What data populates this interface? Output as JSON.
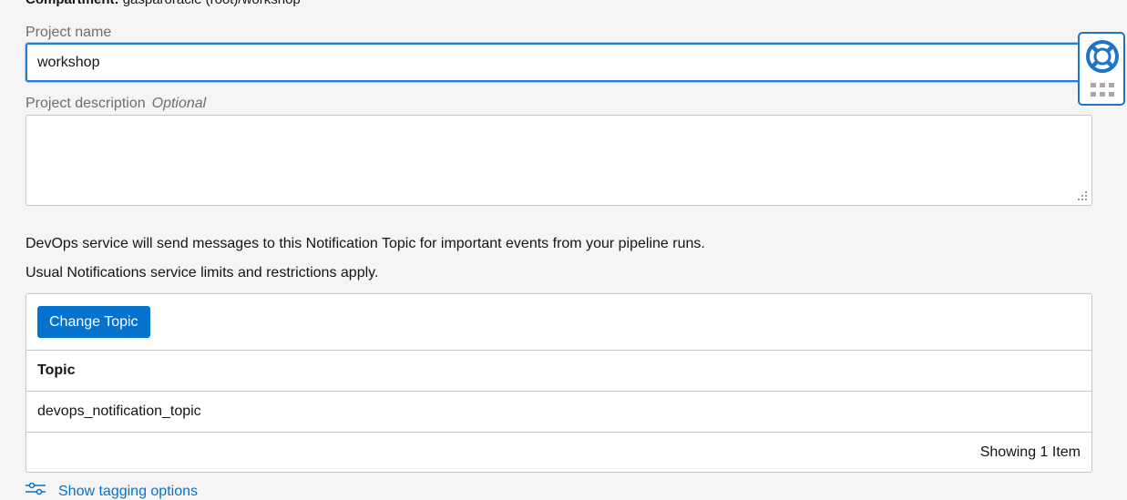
{
  "compartment": {
    "label": "Compartment:",
    "value": "gasparoracle (root)/workshop"
  },
  "project_name": {
    "label": "Project name",
    "value": "workshop"
  },
  "project_description": {
    "label": "Project description",
    "optional_label": "Optional",
    "value": ""
  },
  "notification": {
    "line1": "DevOps service will send messages to this Notification Topic for important events from your pipeline runs.",
    "line2": "Usual Notifications service limits and restrictions apply."
  },
  "topic_table": {
    "change_button_label": "Change Topic",
    "column_header": "Topic",
    "rows": [
      {
        "topic": "devops_notification_topic"
      }
    ],
    "footer": "Showing 1 Item"
  },
  "tagging": {
    "label": "Show tagging options",
    "icon": "tag-options-icon"
  },
  "help_widget": {
    "icon": "lifebuoy-icon",
    "grip_icon": "drag-grip-icon",
    "color": "#1f74c8"
  },
  "colors": {
    "accent": "#0572ce",
    "focus_border": "#227ed6",
    "label_gray": "#6f6e6c",
    "border": "#c7c6c4",
    "background": "#f5f5f5"
  }
}
